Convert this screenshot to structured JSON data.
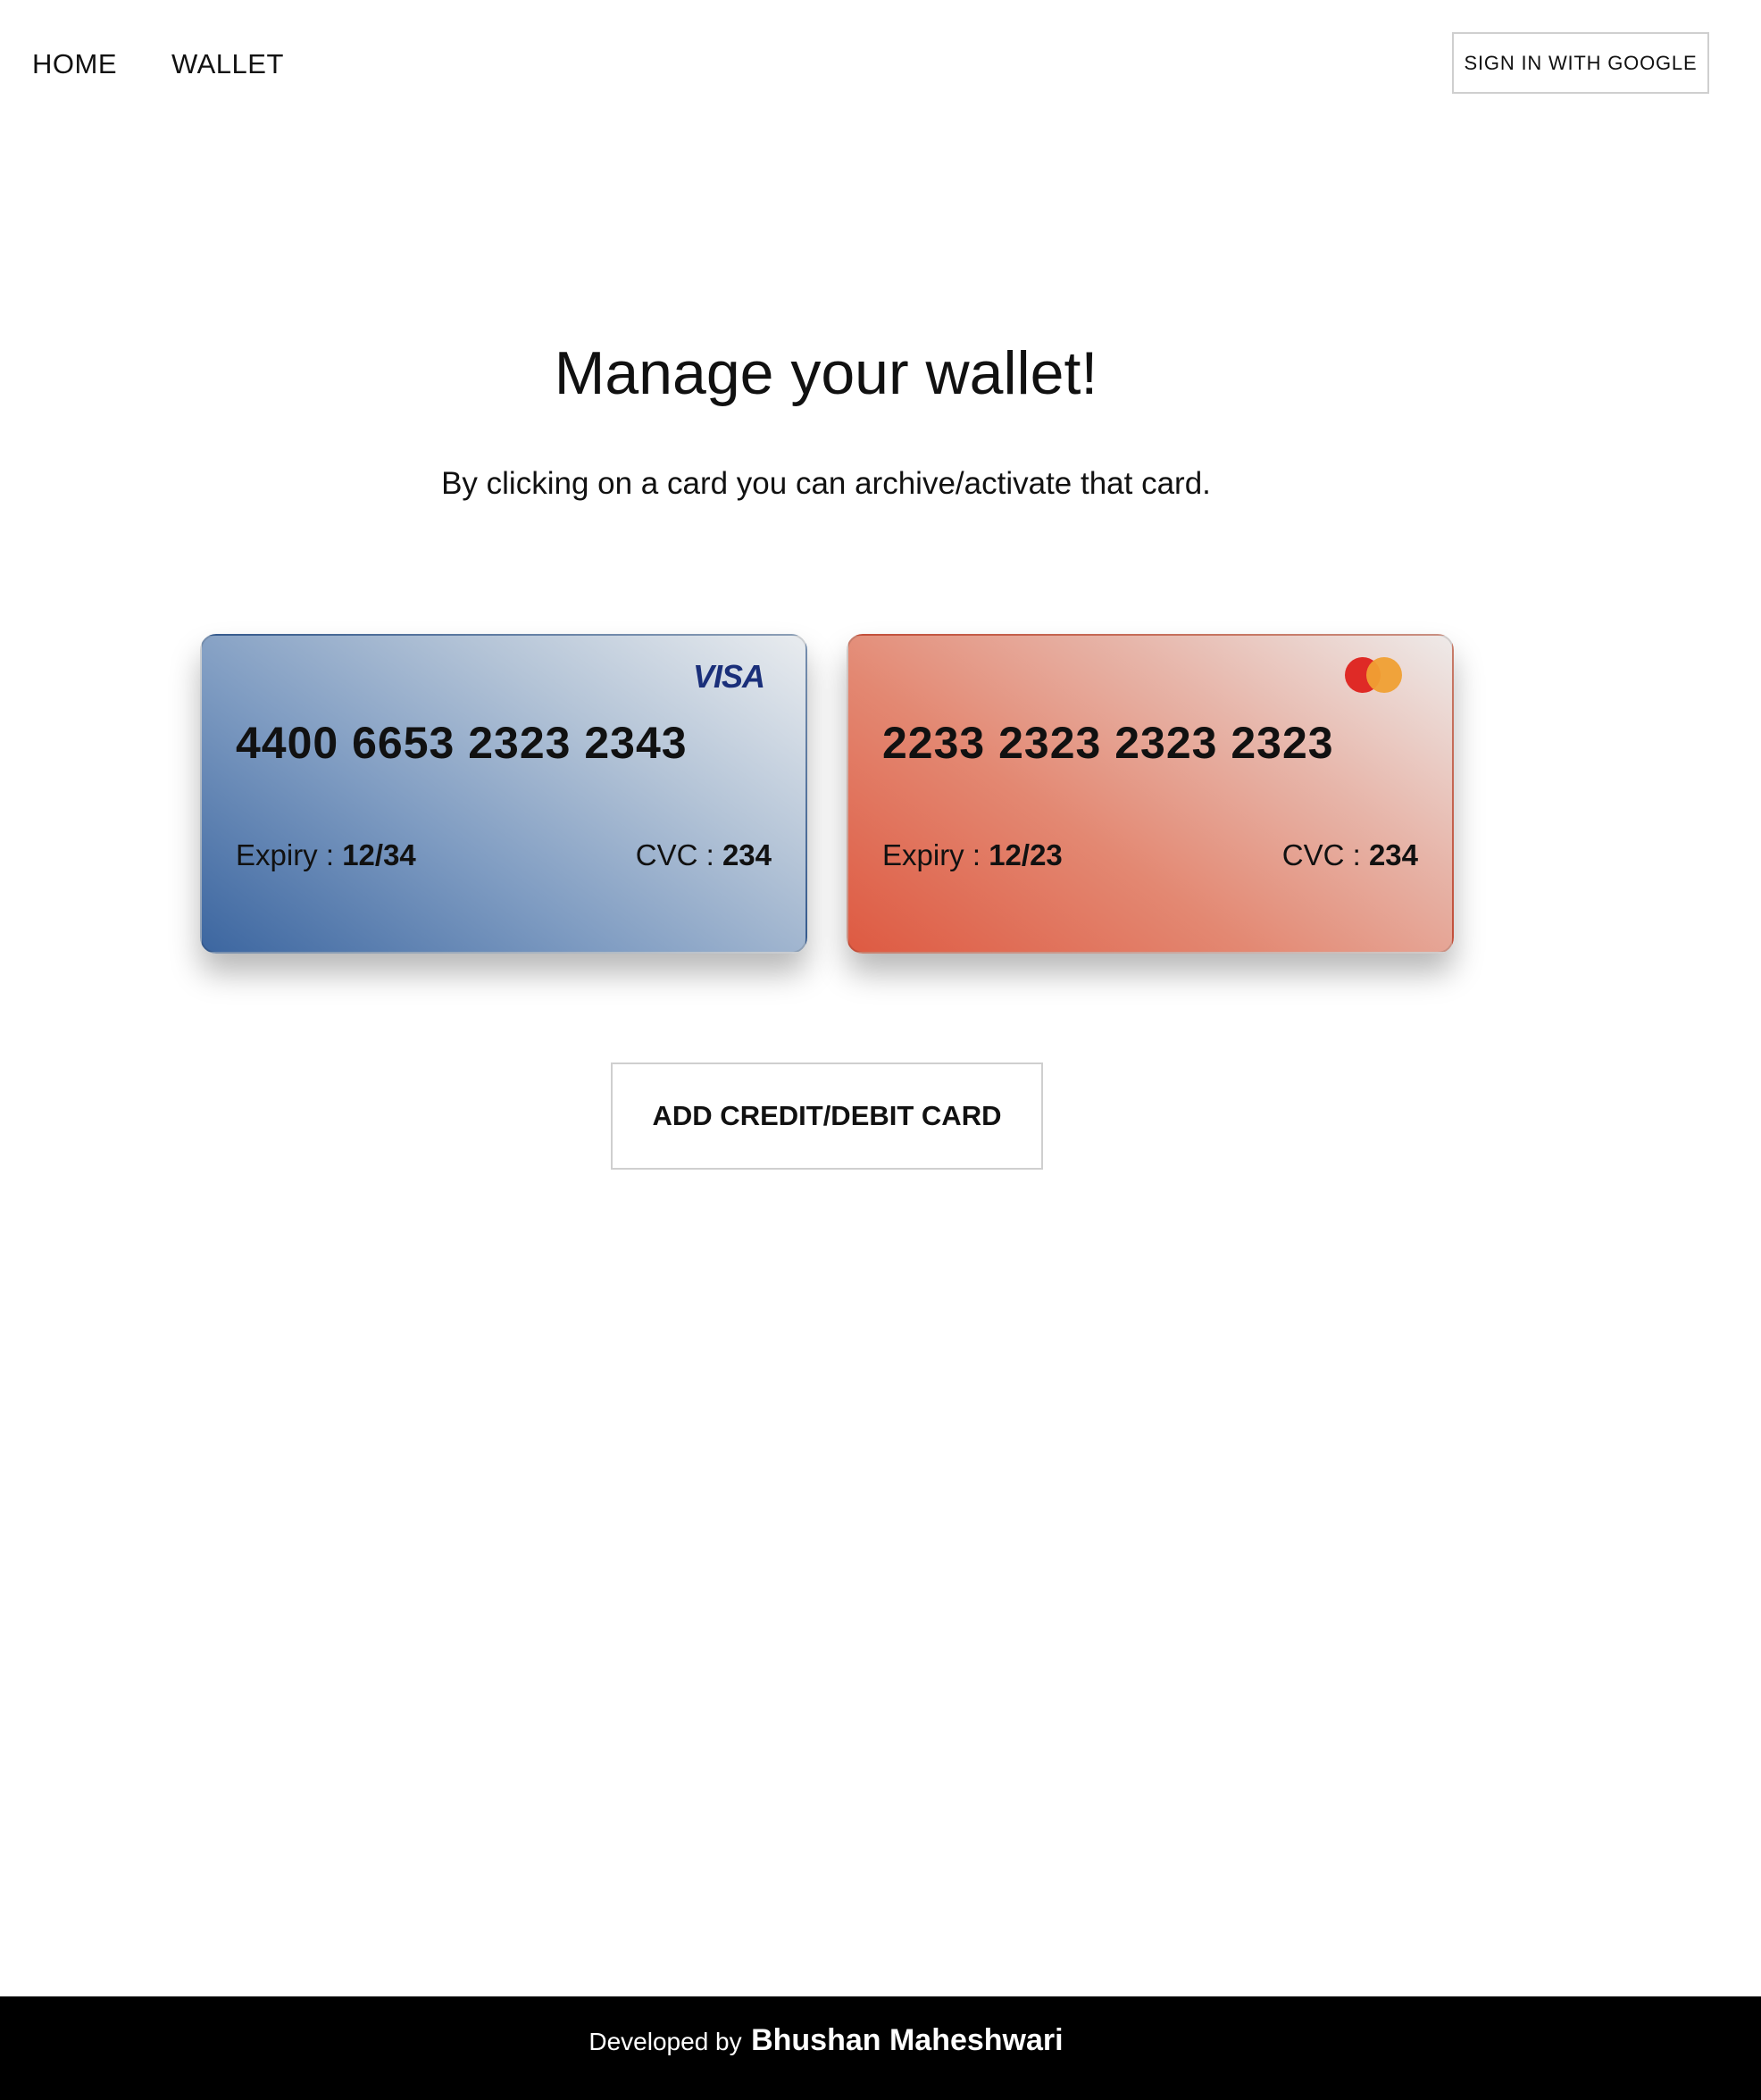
{
  "nav": {
    "home_label": "HOME",
    "wallet_label": "WALLET",
    "signin_label": "SIGN IN WITH GOOGLE"
  },
  "main": {
    "title": "Manage your wallet!",
    "subtitle": "By clicking on a card you can archive/activate that card."
  },
  "cards": [
    {
      "brand": "visa",
      "brand_text": "VISA",
      "number": "4400 6653 2323 2343",
      "expiry_label": "Expiry : ",
      "expiry": "12/34",
      "cvc_label": "CVC : ",
      "cvc": "234",
      "gradient_start": "#3c66a0",
      "gradient_end": "#e9ecef"
    },
    {
      "brand": "mastercard",
      "brand_icon": "mastercard-icon",
      "number": "2233 2323 2323 2323",
      "expiry_label": "Expiry : ",
      "expiry": "12/23",
      "cvc_label": "CVC : ",
      "cvc": "234",
      "gradient_start": "#de5a42",
      "gradient_end": "#eeeae9"
    }
  ],
  "actions": {
    "add_card_label": "ADD CREDIT/DEBIT CARD"
  },
  "footer": {
    "text": "Developed by",
    "name": "Bhushan Maheshwari",
    "background": "#000000"
  }
}
